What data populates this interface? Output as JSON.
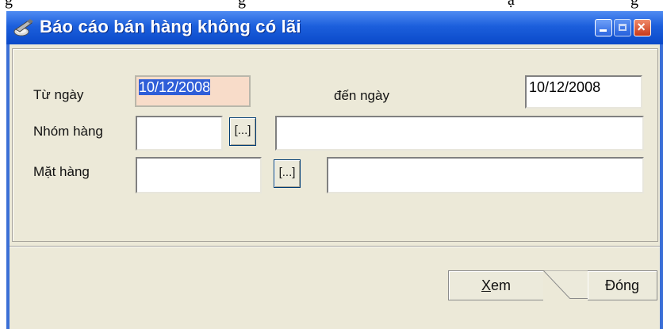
{
  "window": {
    "title": "Báo cáo bán hàng không có lãi",
    "icon": "report-icon"
  },
  "titlebar_buttons": {
    "minimize": "minimize-icon",
    "maximize": "maximize-icon",
    "close": "close-icon"
  },
  "form": {
    "from_date_label": "Từ ngày",
    "from_date_value": "10/12/2008",
    "to_date_label": "đến ngày",
    "to_date_value": "10/12/2008",
    "group_label": "Nhóm hàng",
    "group_code": "",
    "group_name": "",
    "item_label": "Mặt hàng",
    "item_code": "",
    "item_name": "",
    "browse_label": "[...]"
  },
  "buttons": {
    "view_label_prefix": "X",
    "view_label_rest": "em",
    "close_label_prefix": "Đón",
    "close_label_underlined": "g"
  },
  "colors": {
    "titlebar": "#0a49c9",
    "client_bg": "#ece9d8",
    "selected_field_bg": "#f8dcc9"
  }
}
